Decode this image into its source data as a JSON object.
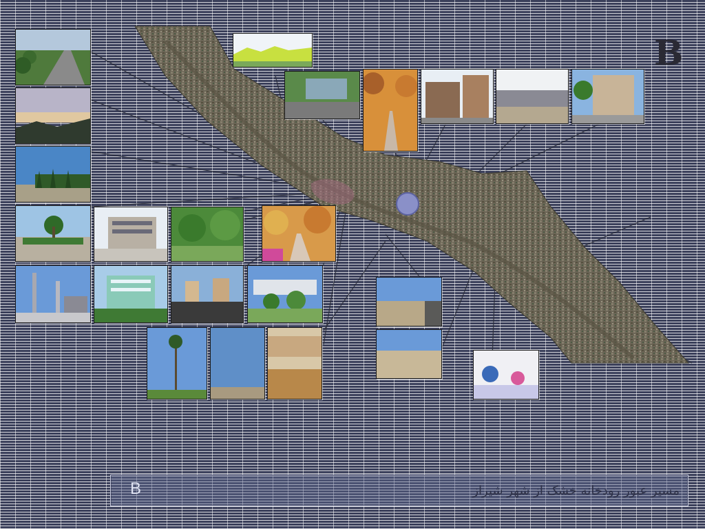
{
  "slide": {
    "corner_label": "B",
    "caption_label": "B",
    "caption_text": "مسیر عبور رودخانه خشک از شهر شیراز"
  },
  "map": {
    "subject": "aerial view of the dry river corridor through the city"
  },
  "photos": [
    {
      "name": "photo-tree-lined-highway",
      "subject": "tree lined highway"
    },
    {
      "name": "photo-sunset-skyline",
      "subject": "sunset over hills"
    },
    {
      "name": "photo-cypress-row",
      "subject": "row of cypress trees"
    },
    {
      "name": "photo-palm-garden",
      "subject": "garden with palm and fountain"
    },
    {
      "name": "photo-modern-building",
      "subject": "modern office building"
    },
    {
      "name": "photo-green-park",
      "subject": "green park"
    },
    {
      "name": "photo-autumn-avenue",
      "subject": "autumn avenue"
    },
    {
      "name": "photo-minaret-square",
      "subject": "minaret and square"
    },
    {
      "name": "photo-glass-tower",
      "subject": "glass office tower"
    },
    {
      "name": "photo-boulevard",
      "subject": "city boulevard"
    },
    {
      "name": "photo-garden-building",
      "subject": "garden and low building"
    },
    {
      "name": "photo-tall-palms",
      "subject": "tall palm trees"
    },
    {
      "name": "photo-clear-sky",
      "subject": "clear sky and roadside"
    },
    {
      "name": "photo-riverbed-mud",
      "subject": "dry riverbed with mud"
    },
    {
      "name": "photo-dry-channel",
      "subject": "dry river channel"
    },
    {
      "name": "photo-dry-channel-wide",
      "subject": "wide dry river channel"
    },
    {
      "name": "photo-blue-domed-shrine",
      "subject": "blue domed shrine"
    },
    {
      "name": "photo-riverside-park",
      "subject": "riverside park"
    },
    {
      "name": "photo-canal-walkway",
      "subject": "canal walkway"
    },
    {
      "name": "photo-plane-tree-alley",
      "subject": "plane tree alley"
    },
    {
      "name": "photo-brick-buildings",
      "subject": "brick buildings"
    },
    {
      "name": "photo-embankment-wall",
      "subject": "river embankment wall"
    },
    {
      "name": "photo-hotel-building",
      "subject": "hotel building"
    }
  ]
}
